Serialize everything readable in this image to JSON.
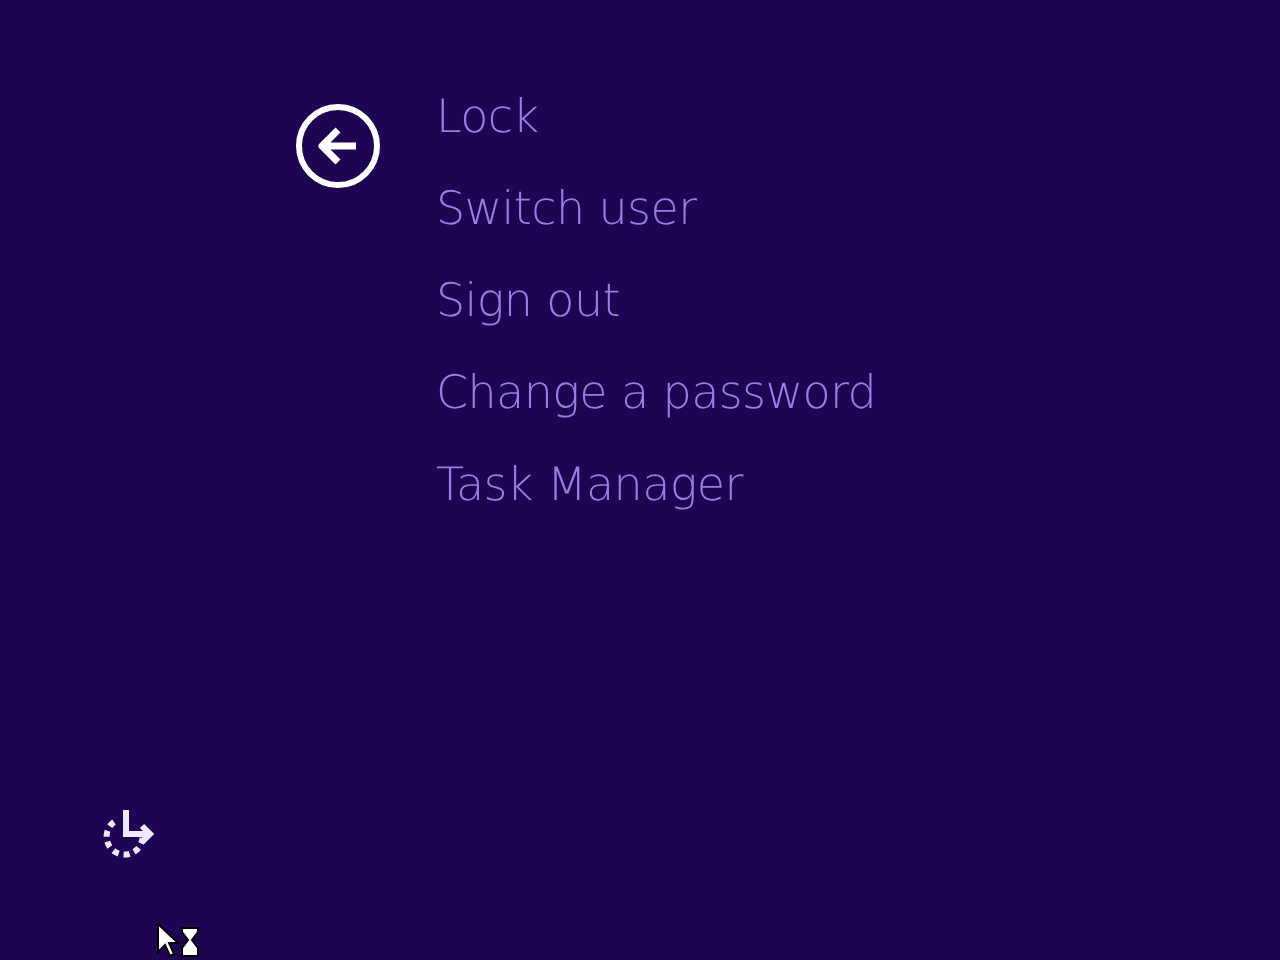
{
  "menu_items": [
    {
      "label": "Lock"
    },
    {
      "label": "Switch user"
    },
    {
      "label": "Sign out"
    },
    {
      "label": "Change a password"
    },
    {
      "label": "Task Manager"
    }
  ]
}
